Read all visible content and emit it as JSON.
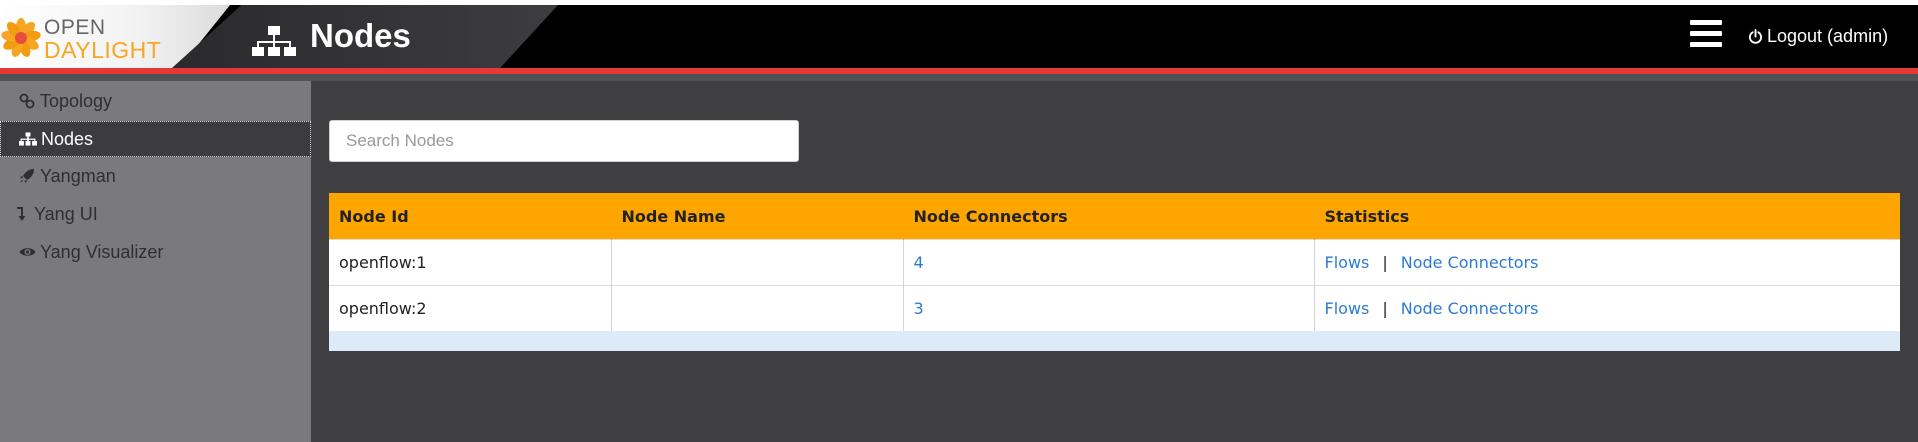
{
  "brand": {
    "line1": "OPEN",
    "line2": "DAYLIGHT",
    "accent_color": "#f6a623"
  },
  "header": {
    "title": "Nodes",
    "title_icon": "sitemap-icon",
    "menu_icon": "hamburger-icon",
    "logout_label": "Logout (admin)",
    "logout_icon": "power-icon",
    "accent_color": "#e53935"
  },
  "sidebar": {
    "items": [
      {
        "label": "Topology",
        "icon": "link-icon"
      },
      {
        "label": "Nodes",
        "icon": "sitemap-icon",
        "active": true
      },
      {
        "label": "Yangman",
        "icon": "rocket-icon"
      },
      {
        "label": "Yang UI",
        "icon": "level-down-icon"
      },
      {
        "label": "Yang Visualizer",
        "icon": "eye-icon"
      }
    ]
  },
  "search": {
    "placeholder": "Search Nodes",
    "value": ""
  },
  "table": {
    "header_color": "#ffa500",
    "columns": [
      "Node Id",
      "Node Name",
      "Node Connectors",
      "Statistics"
    ],
    "rows": [
      {
        "node_id": "openflow:1",
        "node_name": "",
        "connectors": "4",
        "stat_flows": "Flows",
        "stat_sep": "|",
        "stat_connectors": "Node Connectors"
      },
      {
        "node_id": "openflow:2",
        "node_name": "",
        "connectors": "3",
        "stat_flows": "Flows",
        "stat_sep": "|",
        "stat_connectors": "Node Connectors"
      }
    ]
  }
}
